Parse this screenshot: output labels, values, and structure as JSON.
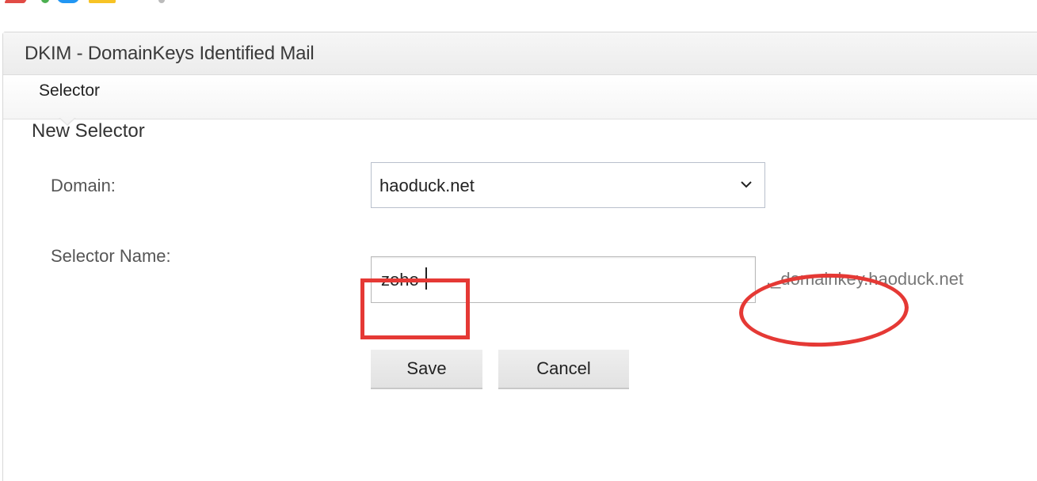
{
  "panel": {
    "title": "DKIM - DomainKeys Identified Mail"
  },
  "tabs": {
    "selector_label": "Selector"
  },
  "form": {
    "section_title": "New Selector",
    "domain_label": "Domain:",
    "domain_value": "haoduck.net",
    "selector_name_label": "Selector Name:",
    "selector_name_value": "zoho",
    "selector_suffix": "._domainkey.haoduck.net",
    "save_label": "Save",
    "cancel_label": "Cancel"
  },
  "icons": {
    "dropdown": "chevron-down-icon"
  },
  "colors": {
    "annotation": "#e53935",
    "header_bg": "#efefef",
    "button_bg": "#e8e8e8"
  }
}
